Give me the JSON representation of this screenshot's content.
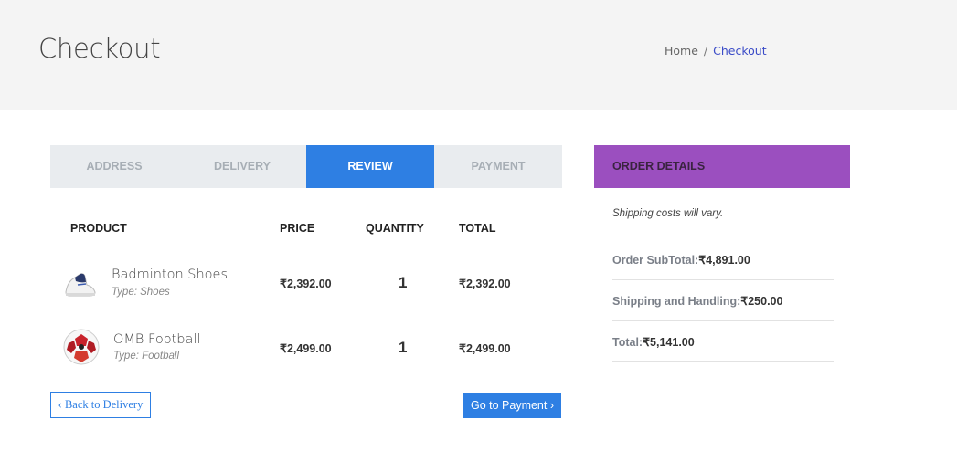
{
  "header": {
    "title": "Checkout",
    "breadcrumb": {
      "home": "Home",
      "separator": "/",
      "current": "Checkout"
    }
  },
  "steps": [
    {
      "label": "ADDRESS",
      "active": false
    },
    {
      "label": "DELIVERY",
      "active": false
    },
    {
      "label": "REVIEW",
      "active": true
    },
    {
      "label": "PAYMENT",
      "active": false
    }
  ],
  "table": {
    "headers": {
      "product": "PRODUCT",
      "price": "PRICE",
      "quantity": "QUANTITY",
      "total": "TOTAL"
    },
    "rows": [
      {
        "name": "Badminton Shoes",
        "type": "Type: Shoes",
        "price": "₹2,392.00",
        "quantity": "1",
        "total": "₹2,392.00",
        "icon": "shoe-icon"
      },
      {
        "name": "OMB Football",
        "type": "Type: Football",
        "price": "₹2,499.00",
        "quantity": "1",
        "total": "₹2,499.00",
        "icon": "football-icon"
      }
    ]
  },
  "buttons": {
    "back": "‹ Back to Delivery",
    "payment": "Go to Payment ›"
  },
  "order_details": {
    "heading": "ORDER DETAILS",
    "note": "Shipping costs will vary.",
    "subtotal_label": "Order SubTotal:",
    "subtotal_value": "₹4,891.00",
    "shipping_label": "Shipping and Handling:",
    "shipping_value": "₹250.00",
    "total_label": "Total:",
    "total_value": "₹5,141.00"
  },
  "colors": {
    "accent": "#2e7fe3",
    "order_header": "#9b4fbf",
    "hero_bg": "#f4f4f4"
  }
}
